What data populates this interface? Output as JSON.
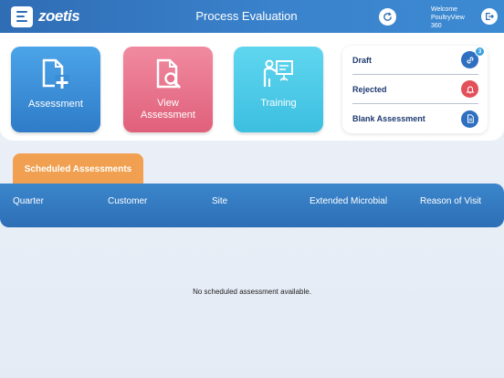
{
  "header": {
    "brand": "zoetis",
    "title": "Process Evaluation",
    "welcome_line1": "Welcome",
    "welcome_line2": "PoultryView",
    "welcome_line3": "360"
  },
  "tiles": {
    "assessment": "Assessment",
    "view_line1": "View",
    "view_line2": "Assessment",
    "training": "Training"
  },
  "status": {
    "draft": "Draft",
    "draft_count": "3",
    "rejected": "Rejected",
    "blank": "Blank Assessment"
  },
  "tab": {
    "label": "Scheduled Assessments"
  },
  "table": {
    "columns": [
      "Quarter",
      "Customer",
      "Site",
      "Extended Microbial",
      "Reason of Visit"
    ],
    "empty_message": "No scheduled assessment available."
  },
  "colors": {
    "header": "#2f6db5",
    "assessment_tile": "#3a8fd8",
    "view_tile": "#e8728c",
    "training_tile": "#4ccae8",
    "tab": "#f0a050",
    "table_header": "#2d6fb6",
    "rejected": "#e2505a"
  },
  "icons": [
    "menu-icon",
    "sync-icon",
    "logout-icon",
    "add-document-icon",
    "search-document-icon",
    "teacher-board-icon",
    "link-icon",
    "bell-icon",
    "document-icon"
  ]
}
